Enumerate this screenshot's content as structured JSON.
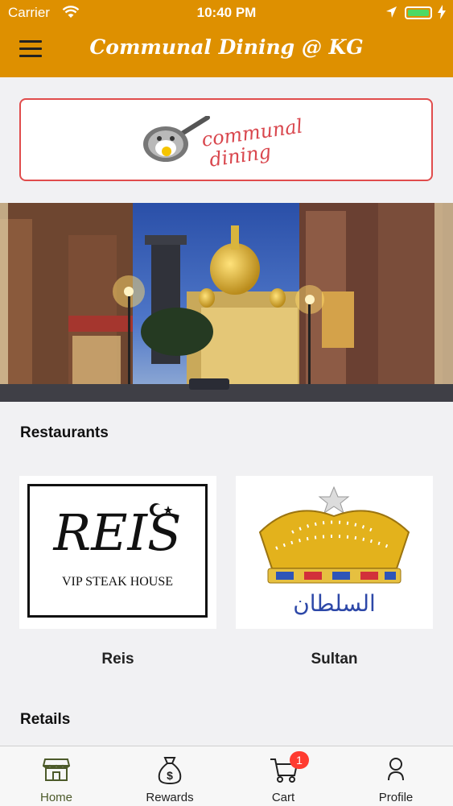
{
  "status_bar": {
    "carrier": "Carrier",
    "time": "10:40 PM"
  },
  "header": {
    "title": "Communal Dining @ KG"
  },
  "brand": {
    "logo_text_line1": "communal",
    "logo_text_line2": "dining"
  },
  "sections": {
    "restaurants_title": "Restaurants",
    "retails_title": "Retails"
  },
  "restaurants": [
    {
      "name": "Reis",
      "logo_main": "REIS",
      "logo_sub": "VIP STEAK HOUSE"
    },
    {
      "name": "Sultan",
      "logo_text": "السلطان"
    }
  ],
  "tabs": [
    {
      "label": "Home",
      "icon": "store-icon",
      "active": true
    },
    {
      "label": "Rewards",
      "icon": "money-bag-icon"
    },
    {
      "label": "Cart",
      "icon": "cart-icon",
      "badge": "1"
    },
    {
      "label": "Profile",
      "icon": "person-icon"
    }
  ],
  "colors": {
    "header": "#de9000",
    "accent_red": "#e04c4c",
    "active_tab": "#4c5a2a",
    "badge": "#ff3b30"
  }
}
